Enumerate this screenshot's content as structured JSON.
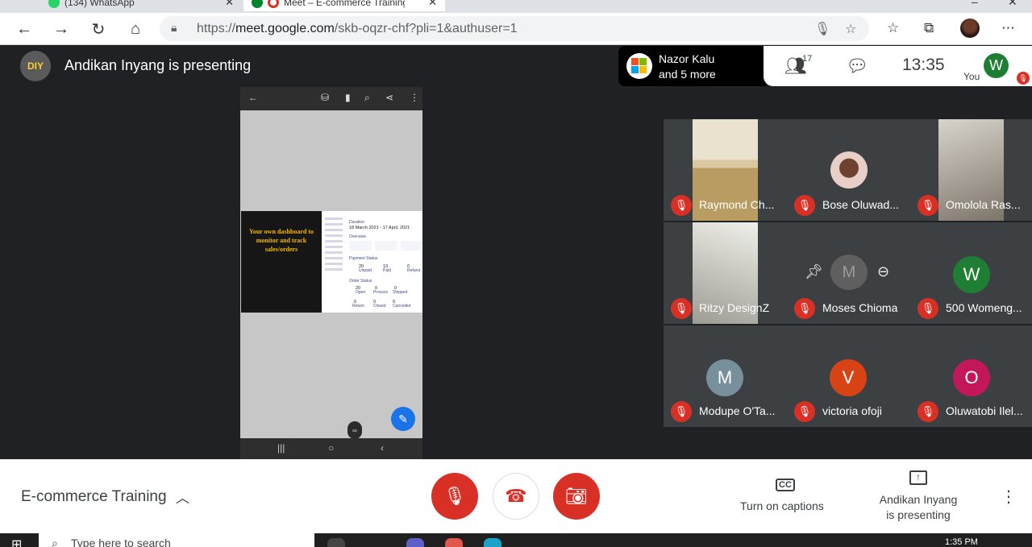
{
  "browser": {
    "tabs": [
      {
        "label": "(134) WhatsApp"
      },
      {
        "label": "Meet – E-commerce Training"
      }
    ],
    "url_prefix": "https://",
    "url_host": "meet.google.com",
    "url_path": "/skb-oqzr-chf?pli=1&authuser=1"
  },
  "header": {
    "presenter_avatar_text": "DIY",
    "presenter_text": "Andikan Inyang is presenting",
    "joined_name": "Nazor Kalu",
    "joined_more": "and 5 more",
    "people_count": "17",
    "time": "13:35",
    "self_initial": "W",
    "self_label": "You"
  },
  "presentation": {
    "slide_text": "Your own dashboard to monitor and track sales/orders",
    "duration_label": "Duration",
    "duration_value": "18 March 2021 - 17 April, 2021",
    "overview_label": "Overview",
    "payment_status_label": "Payment Status",
    "unpaid": "20",
    "unpaid_label": "Unpaid",
    "paid": "13",
    "paid_label": "Paid",
    "refund": "0",
    "refund_label": "Refund",
    "order_status_label": "Order Status",
    "open": "20",
    "open_label": "Open",
    "process": "0",
    "process_label": "Process",
    "shipped": "0",
    "shipped_label": "Shipped",
    "return": "0",
    "return_label": "Return",
    "closed": "0",
    "closed_label": "Closed",
    "cancelled": "0",
    "cancelled_label": "Cancelled"
  },
  "participants": [
    {
      "name": "Raymond Ch...",
      "initial": "",
      "color": "",
      "video": true
    },
    {
      "name": "Bose Oluwad...",
      "initial": "",
      "color": "#c8a27a",
      "video": false,
      "photo": true
    },
    {
      "name": "Omolola Ras...",
      "initial": "",
      "color": "",
      "video": true
    },
    {
      "name": "Ritzy DesignZ",
      "initial": "",
      "color": "",
      "video": true
    },
    {
      "name": "Moses Chioma",
      "initial": "M",
      "color": "#8a8a8a",
      "video": false
    },
    {
      "name": "500 Womeng...",
      "initial": "W",
      "color": "#1e7e34",
      "video": false
    },
    {
      "name": "Modupe O'Ta...",
      "initial": "M",
      "color": "#78909c",
      "video": false
    },
    {
      "name": "victoria ofoji",
      "initial": "V",
      "color": "#d84315",
      "video": false
    },
    {
      "name": "Oluwatobi Ilel...",
      "initial": "O",
      "color": "#c2185b",
      "video": false
    }
  ],
  "controls": {
    "meeting_title": "E-commerce Training",
    "captions_label": "Turn on captions",
    "cc_text": "CC",
    "presenting_line1": "Andikan Inyang",
    "presenting_line2": "is presenting"
  },
  "taskbar": {
    "search_placeholder": "Type here to search",
    "time": "1:35 PM"
  }
}
